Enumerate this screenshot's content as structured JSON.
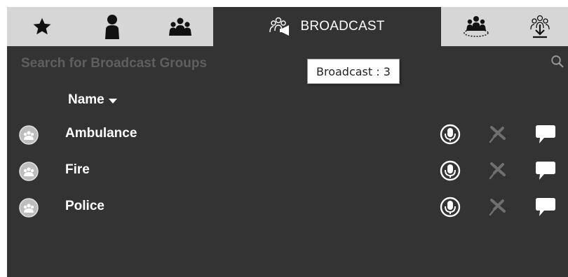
{
  "tabs": [
    {
      "icon": "star-icon"
    },
    {
      "icon": "person-icon"
    },
    {
      "icon": "group-icon"
    },
    {
      "icon": "broadcast-icon",
      "label": "BROADCAST",
      "active": true
    },
    {
      "icon": "group-circle-icon"
    },
    {
      "icon": "group-download-icon"
    }
  ],
  "search": {
    "placeholder": "Search for Broadcast Groups"
  },
  "tooltip": {
    "text": "Broadcast : 3"
  },
  "list": {
    "column_header": "Name",
    "rows": [
      {
        "label": "Ambulance"
      },
      {
        "label": "Fire"
      },
      {
        "label": "Police"
      }
    ]
  },
  "colors": {
    "tab_bar": "#d6d6d6",
    "panel": "#333333",
    "text": "#ffffff",
    "placeholder": "#5f5f5f",
    "muted_icon": "#6f6f6f"
  }
}
